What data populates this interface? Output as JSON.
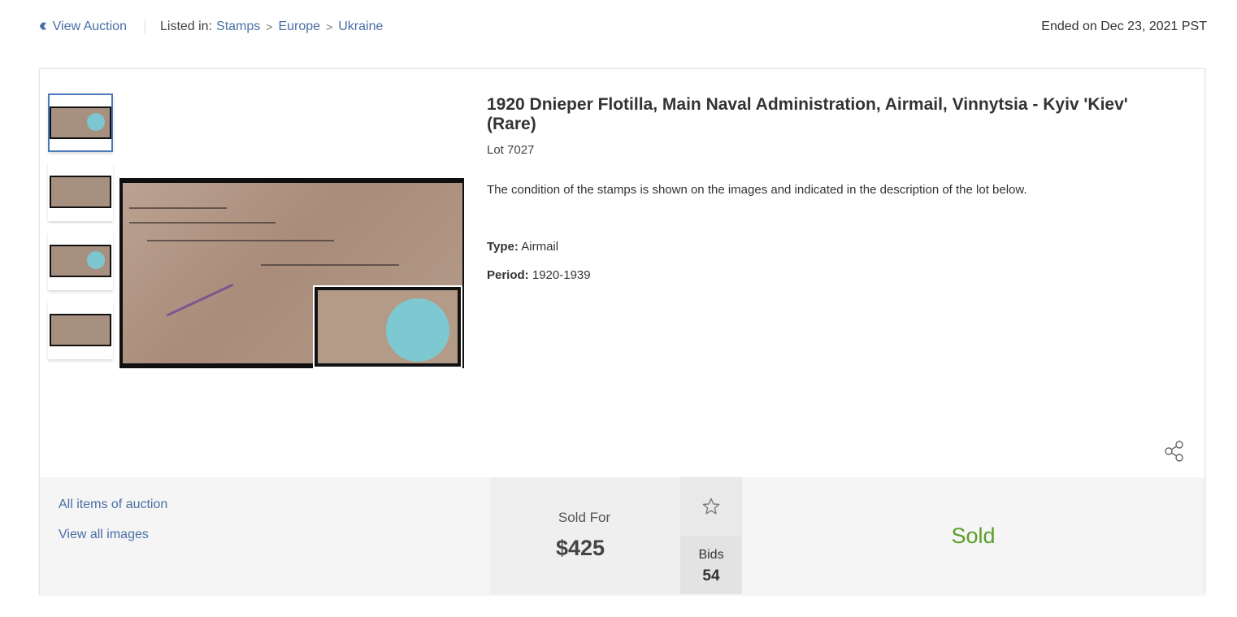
{
  "topbar": {
    "back_label": "View Auction",
    "listed_in_label": "Listed in:",
    "breadcrumbs": [
      "Stamps",
      "Europe",
      "Ukraine"
    ],
    "ended": "Ended on Dec 23, 2021 PST"
  },
  "lot": {
    "title": "1920 Dnieper Flotilla, Main Naval Administration, Airmail, Vinnytsia - Kyiv 'Kiev' (Rare)",
    "number": "Lot 7027",
    "description": "The condition of the stamps is shown on the images and indicated in the description of the lot below.",
    "fields": [
      {
        "label": "Type:",
        "value": "Airmail"
      },
      {
        "label": "Period:",
        "value": "1920-1939"
      }
    ]
  },
  "links": {
    "all_items": "All items of auction",
    "view_images": "View all images"
  },
  "price": {
    "label": "Sold For",
    "value": "$425"
  },
  "bids": {
    "label": "Bids",
    "count": "54"
  },
  "status": {
    "text": "Sold",
    "color": "#5a9e2a"
  },
  "icons": {
    "back": "double-chevron-left-icon",
    "watch": "star-outline-icon",
    "share": "share-icon"
  },
  "colors": {
    "link": "#4a6fa5",
    "active_thumb_border": "#4a7ab8"
  }
}
